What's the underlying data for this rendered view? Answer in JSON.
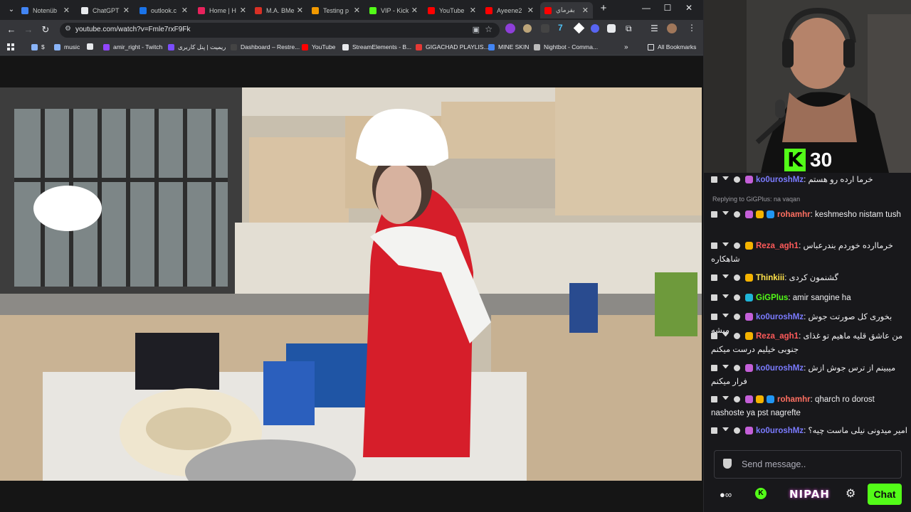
{
  "browser": {
    "tabs": [
      {
        "label": "Notenüb",
        "color": "#4285f4"
      },
      {
        "label": "ChatGPT",
        "color": "#e8eaed"
      },
      {
        "label": "outlook.c",
        "color": "#1a73e8"
      },
      {
        "label": "Home | H",
        "color": "#e8225c"
      },
      {
        "label": "M.A. BMe",
        "color": "#d93025"
      },
      {
        "label": "Testing p",
        "color": "#f29900"
      },
      {
        "label": "VIP - Kick",
        "color": "#53fc18"
      },
      {
        "label": "YouTube",
        "color": "#ff0000"
      },
      {
        "label": "Ayeene2",
        "color": "#ff0000"
      },
      {
        "label": "بفرماي",
        "color": "#ff0000"
      }
    ],
    "url": "youtube.com/watch?v=Fmle7rxF9Fk",
    "bookmarks": [
      {
        "label": "$",
        "color": "#8ab4f8"
      },
      {
        "label": "music",
        "color": "#8ab4f8"
      },
      {
        "label": "",
        "color": "#e8eaed"
      },
      {
        "label": "amir_right - Twitch",
        "color": "#9146ff"
      },
      {
        "label": "ريميت | پنل کاربری",
        "color": "#7b4dff"
      },
      {
        "label": "Dashboard – Restre...",
        "color": "#444"
      },
      {
        "label": "YouTube",
        "color": "#ff0000"
      },
      {
        "label": "StreamElements - B...",
        "color": "#e8eaed"
      },
      {
        "label": "GIGACHAD PLAYLIS...",
        "color": "#e53935"
      },
      {
        "label": "MINE SKIN",
        "color": "#4285f4"
      },
      {
        "label": "Nightbot - Comma...",
        "color": "#bbb"
      }
    ],
    "all_bookmarks": "All Bookmarks"
  },
  "stream": {
    "kick_count": "30",
    "replying_to": "Replying to GiGPlus: na vaqan",
    "messages": [
      {
        "user": "ko0uroshMz",
        "color": "#7b7bff",
        "text": "خرما ارده رو هستم",
        "badges": [
          "#c45fd8"
        ]
      },
      {
        "user": "rohamhr",
        "color": "#ff6f61",
        "text": "keshmesho nistam tush",
        "badges": [
          "#c45fd8",
          "#f5b300",
          "#2196f3"
        ]
      },
      {
        "user": "Reza_agh1",
        "color": "#ff5a5a",
        "text": "خرماارده خوردم بندرعباس شاهکاره",
        "badges": [
          "#f5b300"
        ]
      },
      {
        "user": "Thinkiii",
        "color": "#ffe24a",
        "text": "گشنمون کردی",
        "badges": [
          "#f5b300"
        ]
      },
      {
        "user": "GiGPlus",
        "color": "#53fc18",
        "text": "amir sangine ha",
        "badges": [
          "#1fb5d8"
        ]
      },
      {
        "user": "ko0uroshMz",
        "color": "#7b7bff",
        "text": "بخوری کل صورتت جوش میشه",
        "badges": [
          "#c45fd8"
        ]
      },
      {
        "user": "Reza_agh1",
        "color": "#ff5a5a",
        "text": "من عاشق قلیه ماهیم تو غذای جنوبی خیلیم درست میکنم",
        "badges": [
          "#f5b300"
        ]
      },
      {
        "user": "ko0uroshMz",
        "color": "#7b7bff",
        "text": "میبینم از ترس جوش ازش فرار میکنم",
        "badges": [
          "#c45fd8"
        ]
      },
      {
        "user": "rohamhr",
        "color": "#ff6f61",
        "text": "qharch ro dorost nashoste ya pst nagrefte",
        "badges": [
          "#c45fd8",
          "#f5b300",
          "#2196f3"
        ]
      },
      {
        "user": "ko0uroshMz",
        "color": "#7b7bff",
        "text": "امیر میدونی نیلی ماست چیه؟",
        "badges": [
          "#c45fd8"
        ]
      }
    ],
    "input_placeholder": "Send message..",
    "nipah_label": "NIPAH",
    "chat_button": "Chat"
  }
}
